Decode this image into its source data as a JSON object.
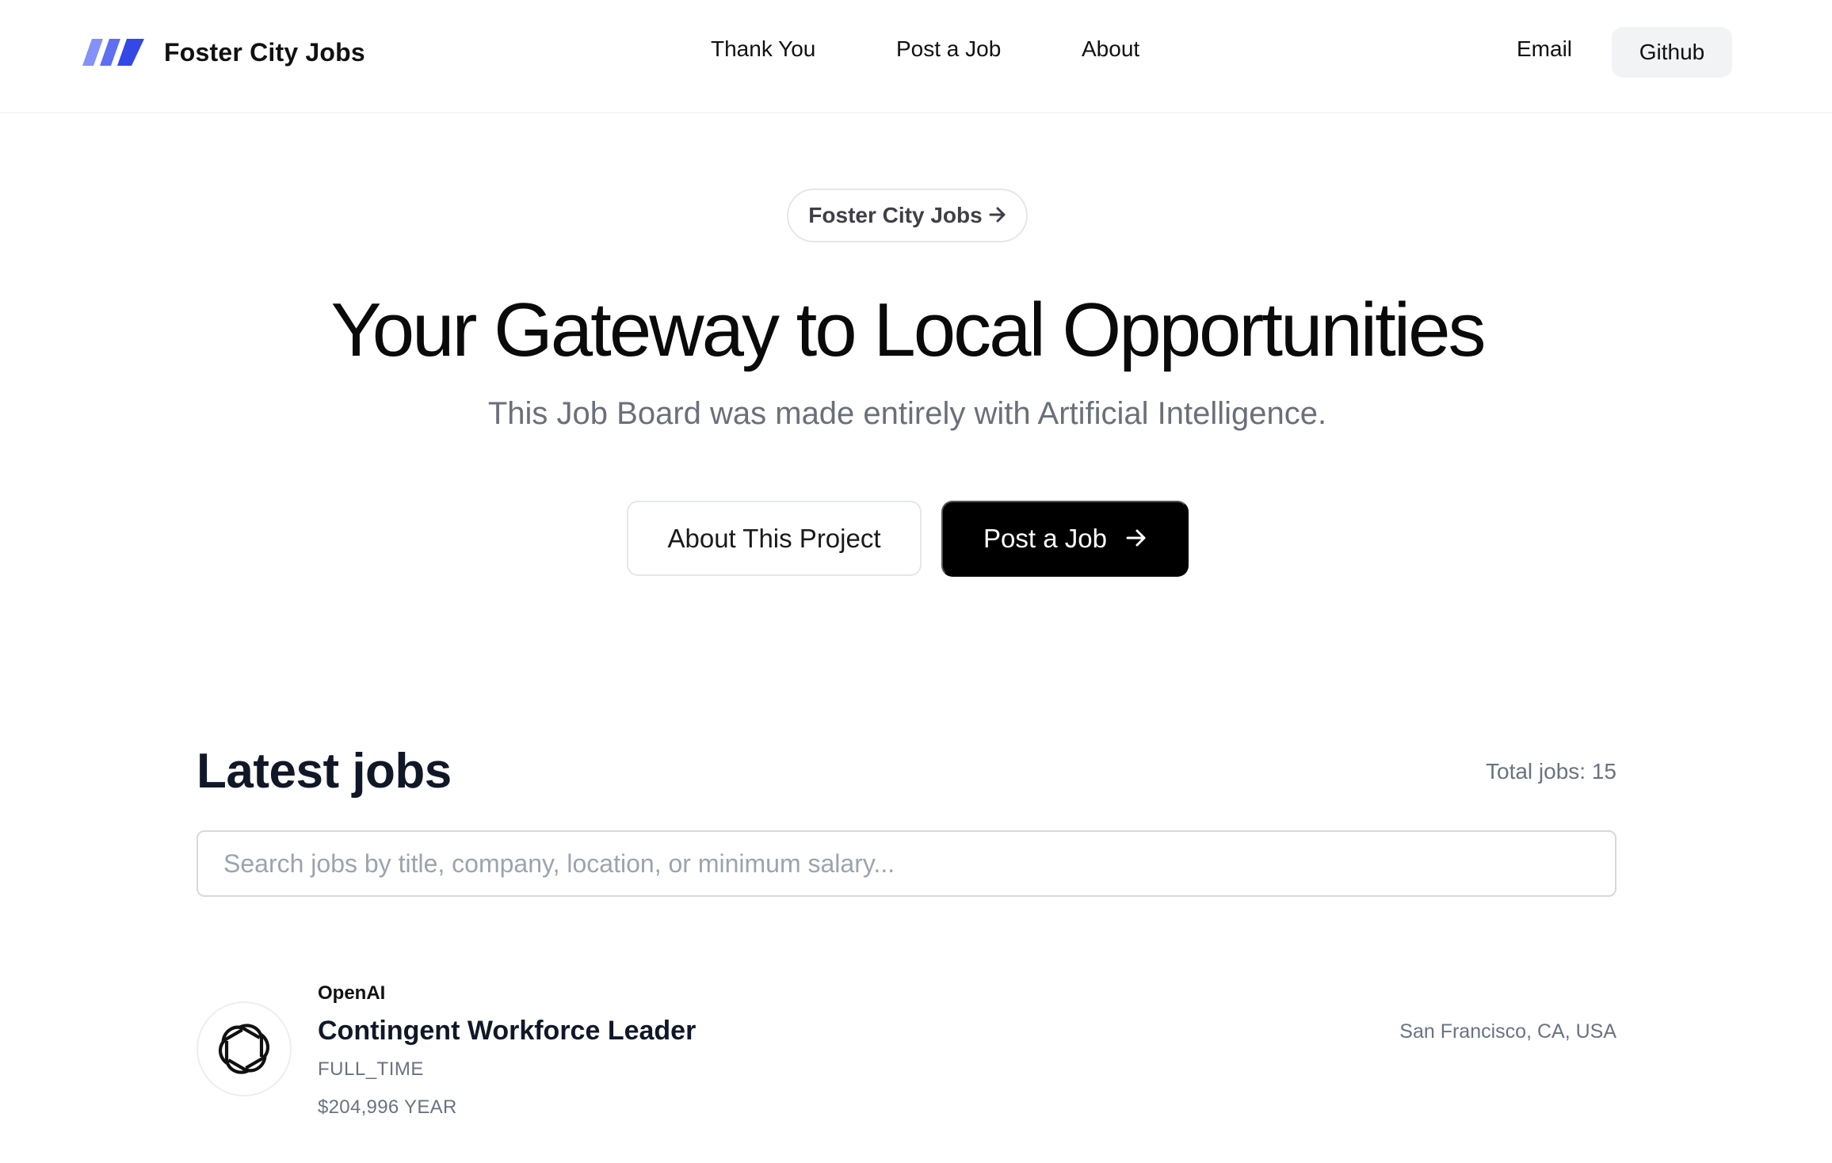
{
  "brand": {
    "name": "Foster City Jobs",
    "logo_colors": [
      "#7c8cf8",
      "#5b6cf0",
      "#3347e6"
    ]
  },
  "nav": {
    "links": [
      "Thank You",
      "Post a Job",
      "About"
    ],
    "email_label": "Email",
    "github_label": "Github"
  },
  "hero": {
    "pill_label": "Foster City Jobs",
    "pill_icon": "arrow-right-icon",
    "title": "Your Gateway to Local Opportunities",
    "subtitle": "This Job Board was made entirely with Artificial Intelligence.",
    "secondary_button": "About This Project",
    "primary_button": "Post a Job",
    "primary_button_icon": "arrow-right-icon"
  },
  "jobs": {
    "heading": "Latest jobs",
    "total_label": "Total jobs: 15",
    "search_placeholder": "Search jobs by title, company, location, or minimum salary...",
    "search_value": "",
    "items": [
      {
        "company": "OpenAI",
        "logo_icon": "openai-logo-icon",
        "title": "Contingent Workforce Leader",
        "type": "FULL_TIME",
        "salary": "$204,996 YEAR",
        "location": "San Francisco, CA, USA"
      }
    ]
  }
}
